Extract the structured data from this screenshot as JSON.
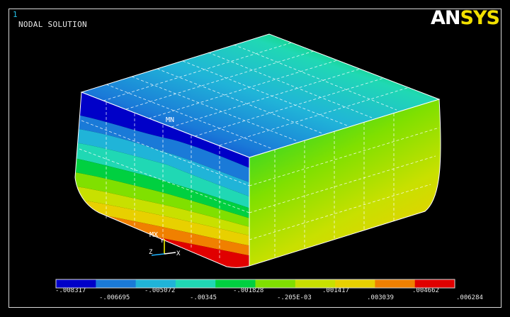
{
  "window_number": "1",
  "plot_title": "NODAL SOLUTION",
  "logo": {
    "part1": "AN",
    "part2": "SYS"
  },
  "markers": {
    "min": "MN",
    "max": "MX"
  },
  "triad": {
    "x": "X",
    "y": "Y",
    "z": "Z"
  },
  "legend": {
    "colors": [
      "#0000c8",
      "#1a7ad8",
      "#20b4d8",
      "#20d8b4",
      "#00d040",
      "#80e000",
      "#c8e000",
      "#e8d000",
      "#f08000",
      "#e00000"
    ],
    "upper_labels": [
      "-.008317",
      "-.005072",
      "-.001828",
      ".001417",
      ".004662"
    ],
    "lower_labels": [
      "-.006695",
      "-.00345",
      "-.205E-03",
      ".003039",
      ".006284"
    ]
  }
}
